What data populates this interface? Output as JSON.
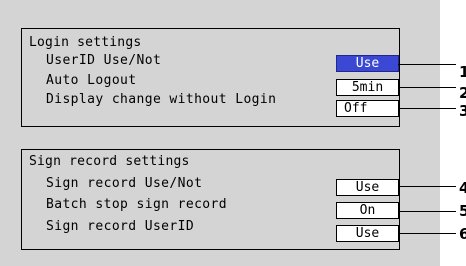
{
  "login_panel": {
    "heading": "Login settings",
    "rows": [
      {
        "label": "UserID Use/Not",
        "value": "Use",
        "callout": "1"
      },
      {
        "label": "Auto Logout",
        "value": "5min",
        "callout": "2"
      },
      {
        "label": "Display change without Login",
        "value": "Off",
        "callout": "3"
      }
    ]
  },
  "sign_panel": {
    "heading": "Sign record settings",
    "rows": [
      {
        "label": "Sign record Use/Not",
        "value": "Use",
        "callout": "4"
      },
      {
        "label": "Batch stop sign record",
        "value": "On",
        "callout": "5"
      },
      {
        "label": "Sign record UserID",
        "value": "Use",
        "callout": "6"
      }
    ]
  },
  "colors": {
    "screen_background": "#d4d4d4",
    "selected_field_background": "#3a48d4",
    "field_background": "#ffffff"
  }
}
